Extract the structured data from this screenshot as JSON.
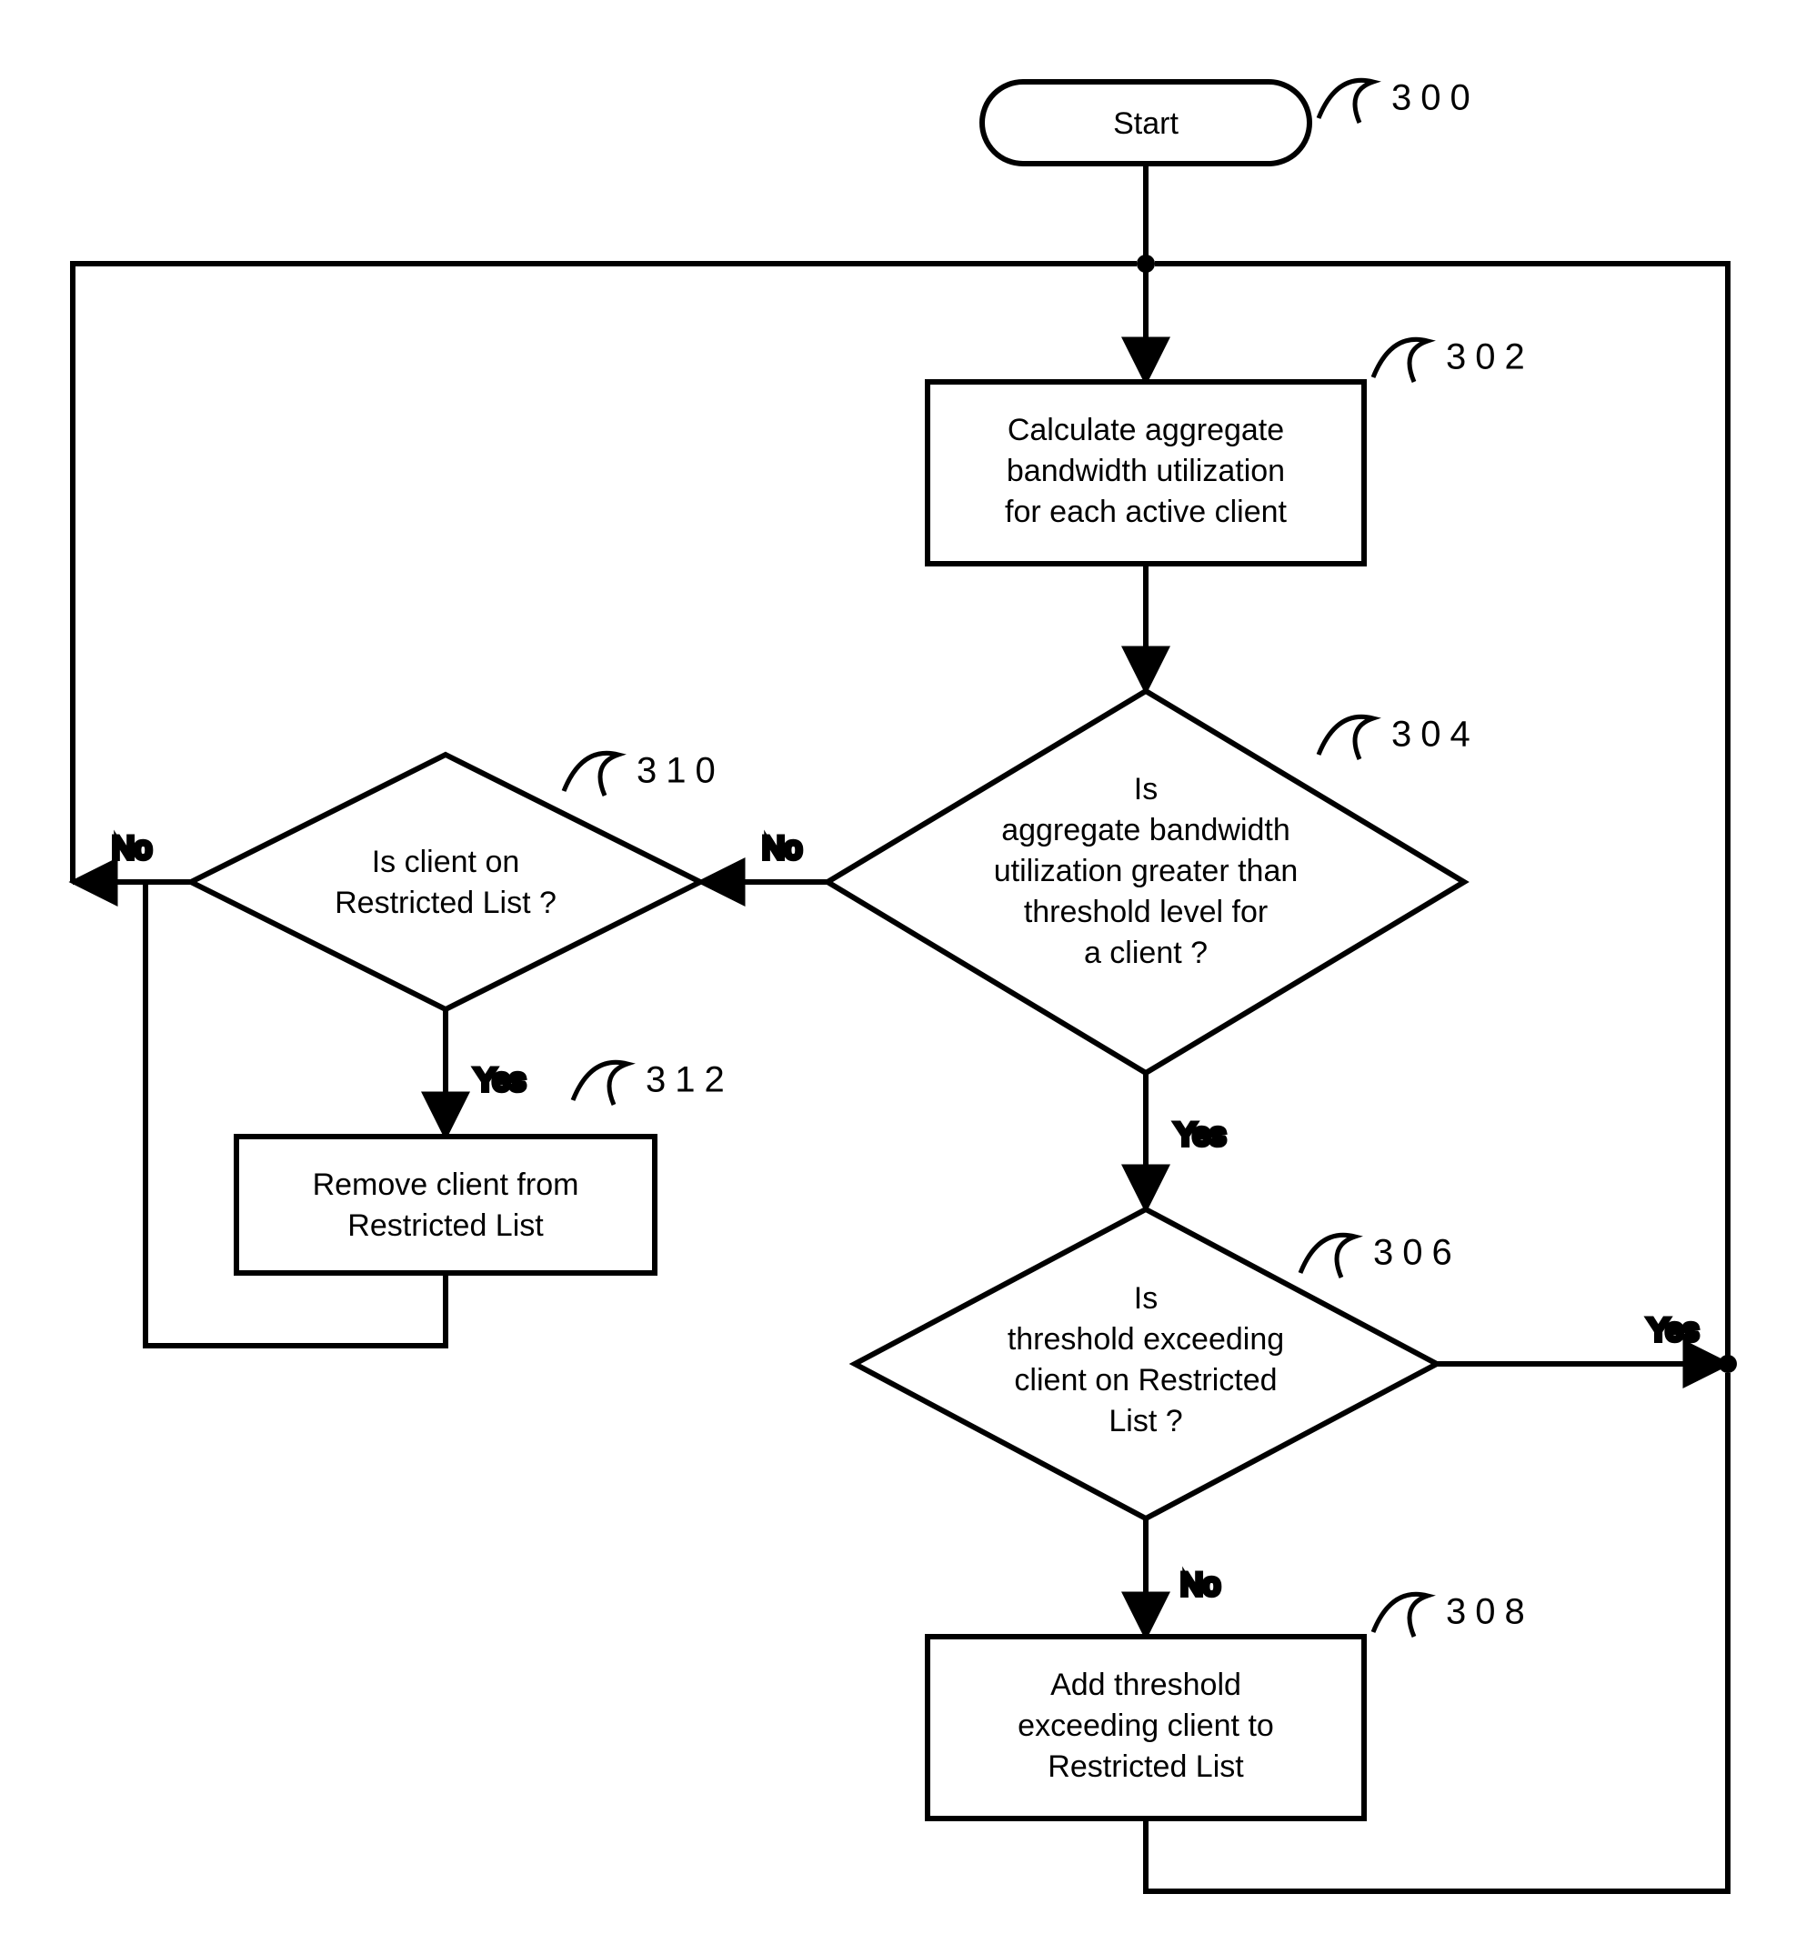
{
  "chart_data": {
    "type": "flowchart",
    "title": "",
    "nodes": [
      {
        "id": "300",
        "shape": "terminator",
        "label": "Start"
      },
      {
        "id": "302",
        "shape": "process",
        "label": "Calculate aggregate bandwidth utilization for each active client"
      },
      {
        "id": "304",
        "shape": "decision",
        "label": "Is aggregate bandwidth utilization greater than threshold level for a client ?"
      },
      {
        "id": "306",
        "shape": "decision",
        "label": "Is threshold exceeding client on Restricted List ?"
      },
      {
        "id": "308",
        "shape": "process",
        "label": "Add threshold exceeding client to Restricted List"
      },
      {
        "id": "310",
        "shape": "decision",
        "label": "Is client on Restricted List ?"
      },
      {
        "id": "312",
        "shape": "process",
        "label": "Remove client from Restricted List"
      }
    ],
    "edges": [
      {
        "from": "300",
        "to": "302",
        "label": ""
      },
      {
        "from": "302",
        "to": "304",
        "label": ""
      },
      {
        "from": "304",
        "to": "306",
        "label": "Yes"
      },
      {
        "from": "304",
        "to": "310",
        "label": "No"
      },
      {
        "from": "306",
        "to": "302",
        "label": "Yes"
      },
      {
        "from": "306",
        "to": "308",
        "label": "No"
      },
      {
        "from": "308",
        "to": "302",
        "label": ""
      },
      {
        "from": "310",
        "to": "302",
        "label": "No"
      },
      {
        "from": "310",
        "to": "312",
        "label": "Yes"
      },
      {
        "from": "312",
        "to": "302",
        "label": ""
      }
    ]
  },
  "labels": {
    "start": "Start",
    "n302_l1": "Calculate aggregate",
    "n302_l2": "bandwidth utilization",
    "n302_l3": "for each active client",
    "n304_l1": "Is",
    "n304_l2": "aggregate bandwidth",
    "n304_l3": "utilization greater than",
    "n304_l4": "threshold level for",
    "n304_l5": "a client ?",
    "n306_l1": "Is",
    "n306_l2": "threshold exceeding",
    "n306_l3": "client on Restricted",
    "n306_l4": "List ?",
    "n308_l1": "Add threshold",
    "n308_l2": "exceeding client to",
    "n308_l3": "Restricted List",
    "n310_l1": "Is client on",
    "n310_l2": "Restricted List ?",
    "n312_l1": "Remove client from",
    "n312_l2": "Restricted List",
    "yes": "Yes",
    "no": "No",
    "r300": "300",
    "r302": "302",
    "r304": "304",
    "r306": "306",
    "r308": "308",
    "r310": "310",
    "r312": "312"
  }
}
